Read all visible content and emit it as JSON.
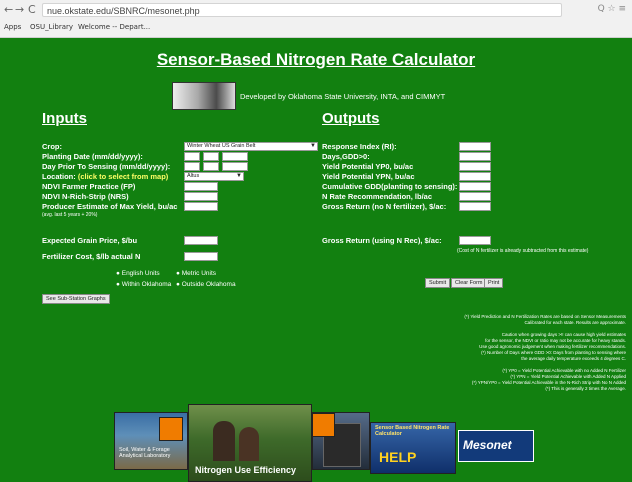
{
  "browser": {
    "back": "←",
    "forward": "→",
    "reload": "C",
    "url": "nue.okstate.edu/SBNRC/mesonet.php",
    "icons": "Q ☆ ≡",
    "bookmarks": [
      "Apps",
      "OSU_Library",
      "Welcome -- Depart..."
    ]
  },
  "page": {
    "title": "Sensor-Based Nitrogen Rate Calculator",
    "developer": "Developed by Oklahoma State University, INTA, and CIMMYT",
    "inputs_header": "Inputs",
    "outputs_header": "Outputs",
    "inputs": {
      "crop_label": "Crop:",
      "crop_value": "Winter Wheat US Grain Belt",
      "planting_label": "Planting Date (mm/dd/yyyy):",
      "sensing_label": "Day Prior To Sensing (mm/dd/yyyy):",
      "location_label": "Location:",
      "location_hint": "(click to select from map)",
      "location_value": "Altus",
      "ndvi_fp_label": "NDVI Farmer Practice (FP)",
      "ndvi_nrs_label": "NDVI N-Rich-Strip (NRS)",
      "max_yield_label": "Producer Estimate of Max Yield, bu/ac",
      "max_yield_note": "(avg. last 5 years + 20%)",
      "grain_price_label": "Expected Grain Price, $/bu",
      "fert_cost_label": "Fertilizer Cost, $/lb actual N",
      "units_english": "English Units",
      "units_metric": "Metric Units",
      "within_ok": "Within Oklahoma",
      "outside_ok": "Outside Oklahoma",
      "see_button": "See Sub-Station Graphs"
    },
    "outputs": {
      "ri_label": "Response Index (RI):",
      "gdd_label": "Days,GDD>0:",
      "ypo_label": "Yield Potential YP0, bu/ac",
      "ypn_label": "Yield Potential YPN, bu/ac",
      "cum_gdd_label": "Cumulative GDD(planting to sensing):",
      "nrate_label": "N Rate Recommendation, lb/ac",
      "gross_no_n_label": "Gross Return (no N fertilizer), $/ac:",
      "gross_n_label": "Gross Return (using N Rec), $/ac:",
      "gross_note": "(Cost of N fertilizer is already subtracted from this estimate)",
      "submit": "Submit",
      "clear": "Clear Form",
      "print": "Print"
    },
    "notes": [
      "(*) Yield Prediction and N Fertilization Rates are based on Sensor Measurements",
      "Calibrated for each state. Results are approximate.",
      "Caution when growing days >!! can cause high yield estimates",
      "for the sensor, the NDVI or ratio may not be accurate for heavy stands.",
      "Use good agronomic judgement when making fertilizer recommendations.",
      "(*) Number of Days where GDD >0: Days from planting to sensing where",
      "the average daily temperature exceeds 4 degrees C.",
      "(*) YP0 = Yield Potential Achievable with no Added N Fertilizer",
      "(*) YPN = Yield Potential Achievable with Added N Applied",
      "(*) YPN/YP0 = Yield Potential Achievable in the N-Rich Strip with No N Added",
      "(*) This is generally 2 times the Average."
    ],
    "banners": {
      "soil": "Soil, Water & Forage Analytical Laboratory",
      "nue": "Nitrogen Use Efficiency",
      "sbnrc": "Sensor Based Nitrogen Rate Calculator",
      "help": "HELP",
      "mesonet": "Mesonet"
    }
  }
}
